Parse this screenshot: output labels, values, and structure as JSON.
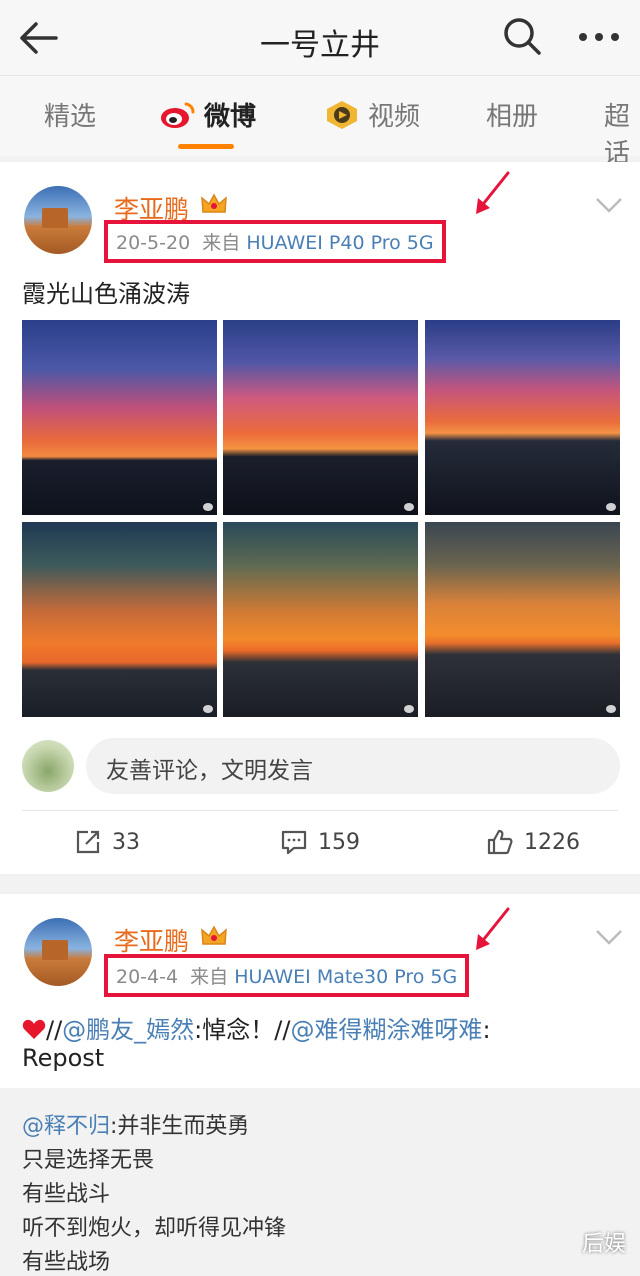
{
  "header": {
    "title": "一号立井"
  },
  "tabs": [
    {
      "label": "精选",
      "active": false
    },
    {
      "label": "微博",
      "active": true
    },
    {
      "label": "视频",
      "active": false
    },
    {
      "label": "相册",
      "active": false
    },
    {
      "label": "超话",
      "active": false
    }
  ],
  "post1": {
    "username": "李亚鹏",
    "date": "20-5-20",
    "from": "来自",
    "device": "HUAWEI P40 Pro 5G",
    "text": "霞光山色涌波涛",
    "comment_placeholder": "友善评论，文明发言",
    "reposts": "33",
    "comments": "159",
    "likes": "1226"
  },
  "post2": {
    "username": "李亚鹏",
    "date": "20-4-4",
    "from": "来自",
    "device": "HUAWEI Mate30 Pro 5G",
    "line1_mention1": "@鹏友_嫣然",
    "line1_text1": ":悼念！",
    "line1_mention2": "@难得糊涂难呀难",
    "line1_text2": ":",
    "line2": "Repost",
    "quote": {
      "mention": "@释不归",
      "first": ":并非生而英勇",
      "lines": [
        "只是选择无畏",
        "有些战斗",
        "听不到炮火，却听得见冲锋",
        "有些战场"
      ]
    }
  },
  "watermark": "后娱",
  "colors": {
    "accent_orange": "#ff8200",
    "username": "#e86a1c",
    "highlight_red": "#e6133a",
    "link_blue": "#4a7fb5"
  }
}
